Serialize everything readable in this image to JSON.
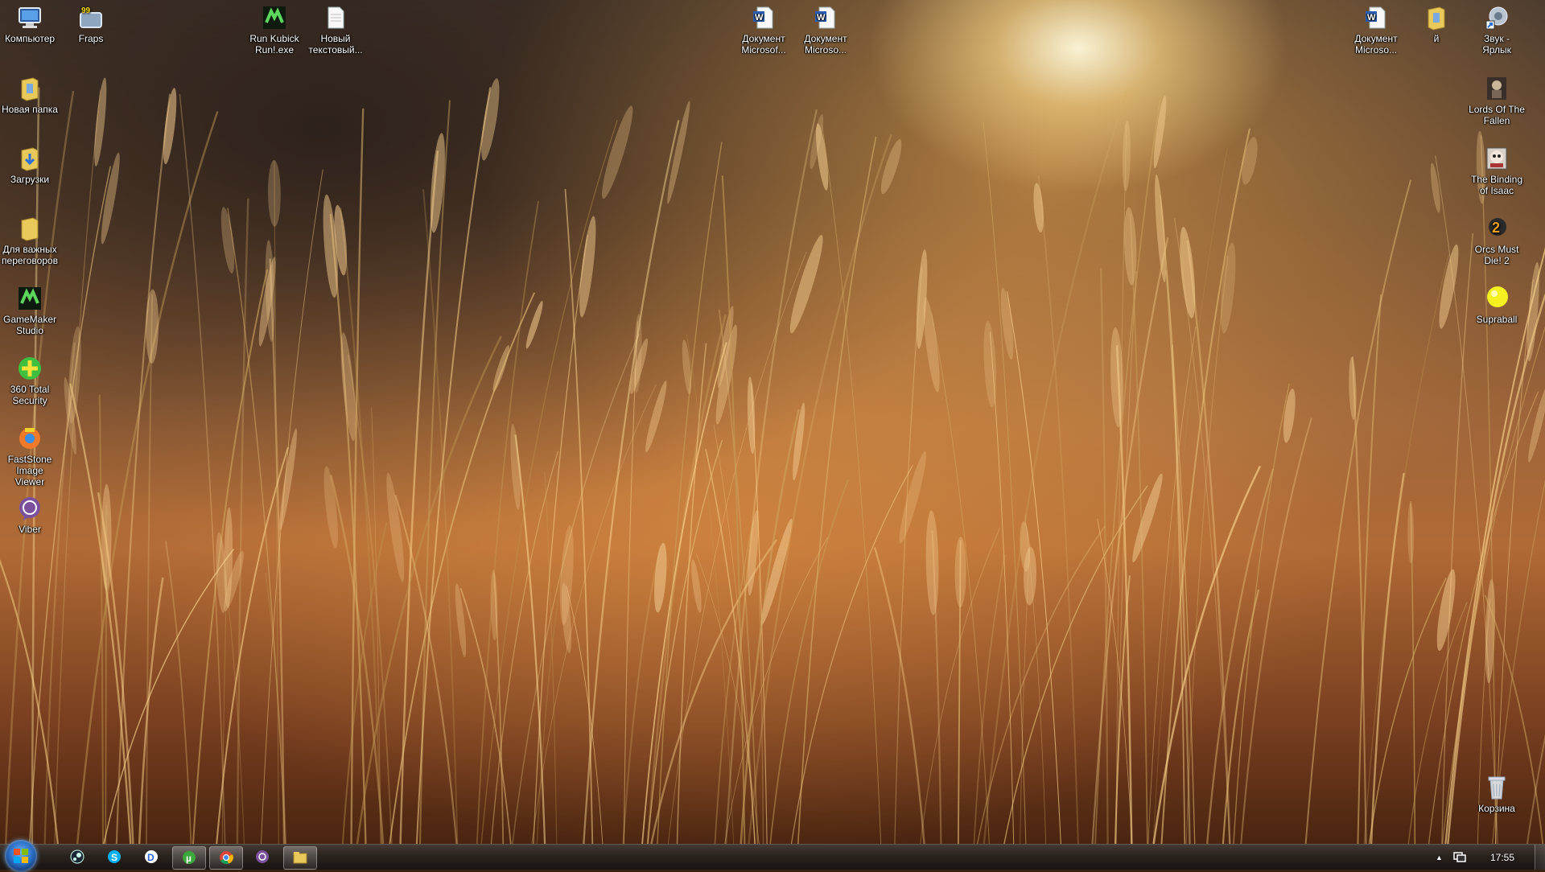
{
  "desktop": {
    "icons_left": [
      {
        "label": "Компьютер",
        "icon": "computer-icon"
      },
      {
        "label": "Новая папка",
        "icon": "folder-icon"
      },
      {
        "label": "Загрузки",
        "icon": "downloads-folder-icon"
      },
      {
        "label": "Для важных переговоров",
        "icon": "folder-icon"
      },
      {
        "label": "GameMaker Studio",
        "icon": "gamemaker-icon"
      },
      {
        "label": "360 Total Security",
        "icon": "360-security-icon"
      },
      {
        "label": "FastStone Image Viewer",
        "icon": "faststone-icon"
      },
      {
        "label": "Viber",
        "icon": "viber-icon"
      }
    ],
    "icons_top": [
      {
        "label": "Fraps",
        "icon": "fraps-icon"
      },
      {
        "label": "Run Kubick Run!.exe",
        "icon": "gamemaker-exe-icon"
      },
      {
        "label": "Новый текстовый...",
        "icon": "text-file-icon"
      },
      {
        "label": "Документ Microsof...",
        "icon": "word-document-icon"
      },
      {
        "label": "Документ Microso...",
        "icon": "word-document-icon"
      },
      {
        "label": "Документ Microso...",
        "icon": "word-document-icon"
      },
      {
        "label": "й",
        "icon": "folder-icon"
      },
      {
        "label": "Звук - Ярлык",
        "icon": "sound-shortcut-icon"
      }
    ],
    "icons_right": [
      {
        "label": "Lords Of The Fallen",
        "icon": "lords-of-the-fallen-icon"
      },
      {
        "label": "The Binding of Isaac",
        "icon": "binding-of-isaac-icon"
      },
      {
        "label": "Orcs Must Die! 2",
        "icon": "orcs-must-die-icon"
      },
      {
        "label": "Supraball",
        "icon": "supraball-icon"
      },
      {
        "label": "Корзина",
        "icon": "recycle-bin-icon"
      }
    ]
  },
  "taskbar": {
    "pinned": [
      {
        "name": "steam",
        "icon": "steam-icon"
      },
      {
        "name": "skype",
        "icon": "skype-icon"
      },
      {
        "name": "daemon-tools",
        "icon": "daemon-tools-icon"
      },
      {
        "name": "utorrent",
        "icon": "utorrent-icon",
        "active": true
      },
      {
        "name": "chrome",
        "icon": "chrome-icon",
        "active": true
      },
      {
        "name": "viber",
        "icon": "viber-icon"
      },
      {
        "name": "explorer",
        "icon": "explorer-icon"
      }
    ],
    "tray_arrow": "▲",
    "clock": "17:55"
  }
}
